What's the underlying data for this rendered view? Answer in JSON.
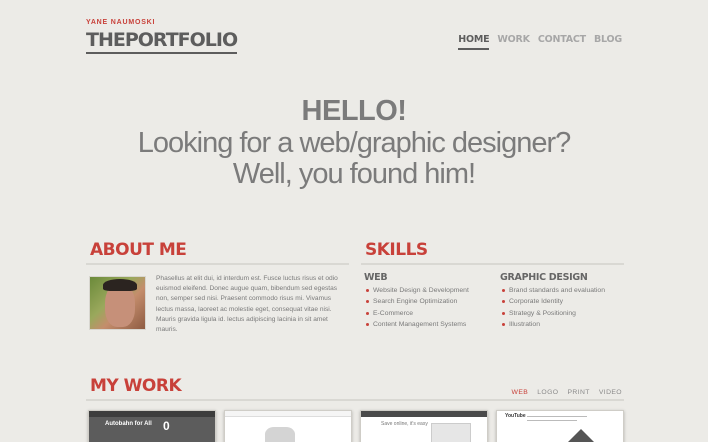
{
  "header": {
    "owner": "YANE NAUMOSKI",
    "title": "THEPORTFOLIO",
    "nav": [
      "HOME",
      "WORK",
      "CONTACT",
      "BLOG"
    ]
  },
  "hero": {
    "line1": "HELLO!",
    "line2": "Looking for a web/graphic designer?",
    "line3": "Well, you found him!"
  },
  "about": {
    "heading": "ABOUT ME",
    "text": "Phasellus at elit dui, id interdum est. Fusce luctus risus et odio euismod eleifend. Donec augue quam, bibendum sed egestas non, semper sed nisi. Praesent commodo risus mi. Vivamus lectus massa, laoreet ac molestie eget, consequat vitae nisi. Mauris gravida ligula id. lectus adipiscing lacinia in sit amet mauris."
  },
  "skills": {
    "heading": "SKILLS",
    "web": {
      "title": "WEB",
      "items": [
        "Website Design & Development",
        "Search Engine Optimization",
        "E-Commerce",
        "Content Management Systems"
      ]
    },
    "graphic": {
      "title": "GRAPHIC DESIGN",
      "items": [
        "Brand standards and evaluation",
        "Corporate Identity",
        "Strategy & Positioning",
        "Illustration"
      ]
    }
  },
  "work": {
    "heading": "MY WORK",
    "filters": [
      "WEB",
      "LOGO",
      "PRINT",
      "VIDEO"
    ],
    "thumb1_text": "Autobahn for All",
    "thumb1_num": "0",
    "thumb3_text": "Save online, it's easy",
    "thumb4_logo": "YouTube"
  },
  "colors": {
    "accent": "#c8413a",
    "background": "#ecebe7",
    "text": "#6f6f6f"
  }
}
